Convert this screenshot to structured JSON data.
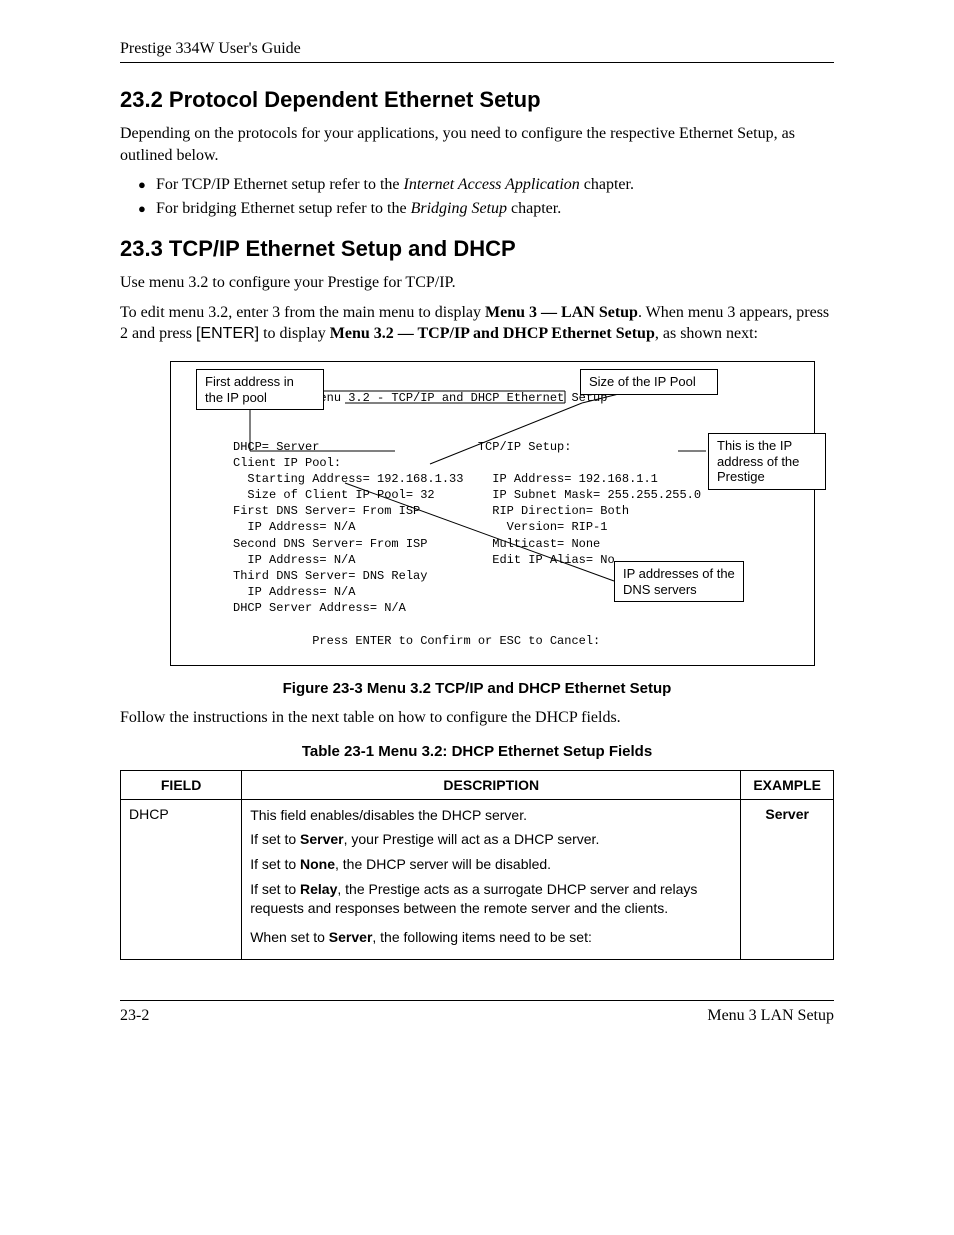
{
  "header": {
    "title": "Prestige 334W User's Guide"
  },
  "section232": {
    "heading": "23.2  Protocol Dependent Ethernet Setup",
    "intro": "Depending on the protocols for your applications, you need to configure the respective Ethernet Setup, as outlined below.",
    "bullets": {
      "b1_pre": "For TCP/IP Ethernet setup refer to the ",
      "b1_em": "Internet Access Application",
      "b1_post": " chapter.",
      "b2_pre": "For bridging Ethernet setup refer to the ",
      "b2_em": "Bridging Setup",
      "b2_post": " chapter."
    }
  },
  "section233": {
    "heading": "23.3  TCP/IP Ethernet Setup and DHCP",
    "p1": "Use menu 3.2 to configure your Prestige for TCP/IP.",
    "p2_pre": "To edit menu 3.2, enter 3 from the main menu to display ",
    "p2_b1": "Menu 3 — LAN Setup",
    "p2_mid": ". When menu 3 appears, press 2 and press ",
    "p2_key": "[ENTER]",
    "p2_mid2": " to display ",
    "p2_b2": "Menu 3.2 — TCP/IP and DHCP Ethernet Setup",
    "p2_post": ", as shown next:"
  },
  "figure": {
    "callouts": {
      "first_addr": "First address in the IP pool",
      "size_pool": "Size of the IP Pool",
      "ip_prestige": "This is the IP address of the Prestige",
      "dns_addr": "IP addresses of the DNS servers"
    },
    "terminal": {
      "title": "           Menu 3.2 - TCP/IP and DHCP Ethernet Setup",
      "left": "DHCP= Server\nClient IP Pool:\n  Starting Address= 192.168.1.33\n  Size of Client IP Pool= 32\nFirst DNS Server= From ISP\n  IP Address= N/A\nSecond DNS Server= From ISP\n  IP Address= N/A\nThird DNS Server= DNS Relay\n  IP Address= N/A\nDHCP Server Address= N/A",
      "right": "TCP/IP Setup:\n\n  IP Address= 192.168.1.1\n  IP Subnet Mask= 255.255.255.0\n  RIP Direction= Both\n    Version= RIP-1\n  Multicast= None\n  Edit IP Alias= No",
      "footer": "           Press ENTER to Confirm or ESC to Cancel:"
    },
    "caption": "Figure 23-3 Menu 3.2 TCP/IP and DHCP Ethernet Setup"
  },
  "after_fig": "Follow the instructions in the next table on how to configure the DHCP fields.",
  "table": {
    "caption": "Table 23-1 Menu 3.2: DHCP Ethernet Setup Fields",
    "headers": {
      "field": "FIELD",
      "desc": "DESCRIPTION",
      "example": "EXAMPLE"
    },
    "row": {
      "field": "DHCP",
      "example": "Server",
      "d_line1": "This field enables/disables the DHCP server.",
      "d_line2_pre": "If set to ",
      "d_line2_b": "Server",
      "d_line2_post": ", your Prestige will act as a DHCP server.",
      "d_line3_pre": "If set to ",
      "d_line3_b": "None",
      "d_line3_post": ", the DHCP server will be disabled.",
      "d_line4_pre": "If set to ",
      "d_line4_b": "Relay",
      "d_line4_post": ", the Prestige acts as a surrogate DHCP server and relays requests and responses between the remote server and the clients.",
      "d_line5_pre": "When set to ",
      "d_line5_b": "Server",
      "d_line5_post": ", the following items need to be set:"
    }
  },
  "footer": {
    "left": "23-2",
    "right": "Menu 3 LAN Setup"
  }
}
